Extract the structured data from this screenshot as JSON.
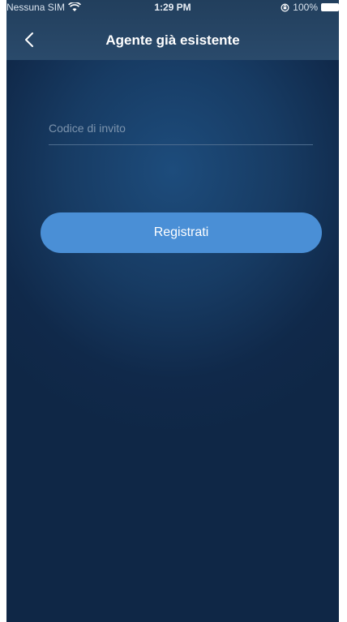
{
  "status_bar": {
    "carrier": "Nessuna SIM",
    "time": "1:29 PM",
    "battery": "100%"
  },
  "nav": {
    "back_icon": "chevron-left-icon",
    "title": "Agente già esistente"
  },
  "form": {
    "invite_code_placeholder": "Codice di invito",
    "invite_code_value": ""
  },
  "actions": {
    "register_label": "Registrati"
  },
  "colors": {
    "background": "#173b63",
    "header": "#2a4a6b",
    "button": "#4a8fd6",
    "placeholder": "#7d94ad"
  }
}
